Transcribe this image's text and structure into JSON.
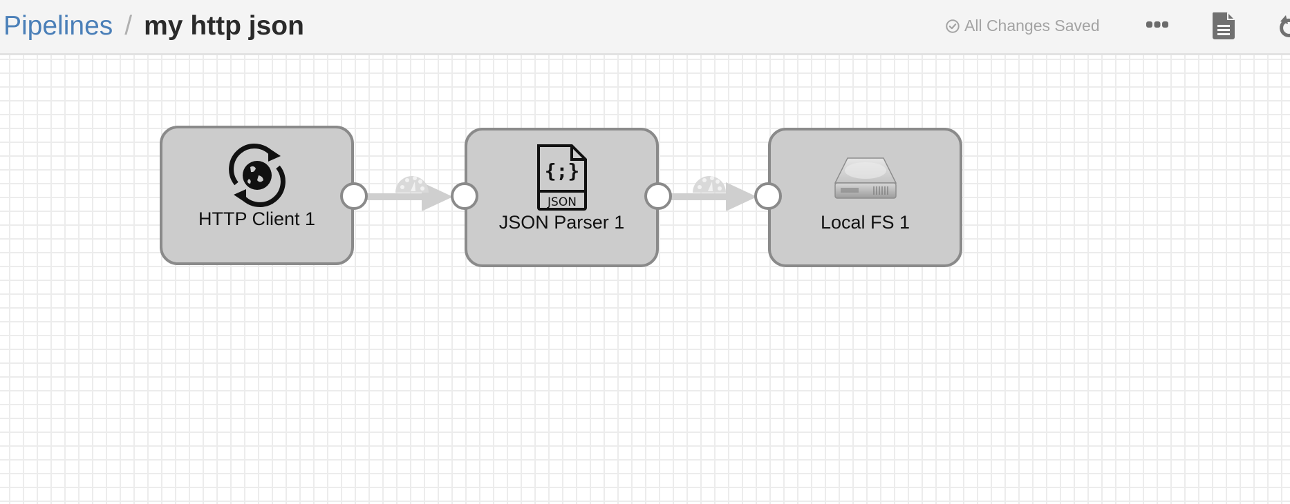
{
  "header": {
    "breadcrumb_root": "Pipelines",
    "breadcrumb_separator": "/",
    "pipeline_name": "my http json",
    "save_status": "All Changes Saved",
    "icons": {
      "status": "check-circle-icon",
      "more": "more-horizontal-icon",
      "document": "document-icon",
      "undo": "undo-icon"
    }
  },
  "pipeline": {
    "stages": [
      {
        "id": "http-client",
        "label": "HTTP Client 1",
        "icon": "http-client-globe-sync-icon",
        "type": "origin"
      },
      {
        "id": "json-parser",
        "label": "JSON Parser 1",
        "icon": "json-file-icon",
        "type": "processor"
      },
      {
        "id": "local-fs",
        "label": "Local FS 1",
        "icon": "hard-drive-icon",
        "type": "destination"
      }
    ],
    "connections": [
      {
        "from": "HTTP Client 1",
        "to": "JSON Parser 1",
        "icon": "gauge-icon"
      },
      {
        "from": "JSON Parser 1",
        "to": "Local FS 1",
        "icon": "gauge-icon"
      }
    ]
  },
  "colors": {
    "link": "#4a7fb8",
    "node_fill": "#cccccc",
    "node_border": "#8a8a8a",
    "edge": "#cfcfcf",
    "status_text": "#a3a3a3"
  }
}
